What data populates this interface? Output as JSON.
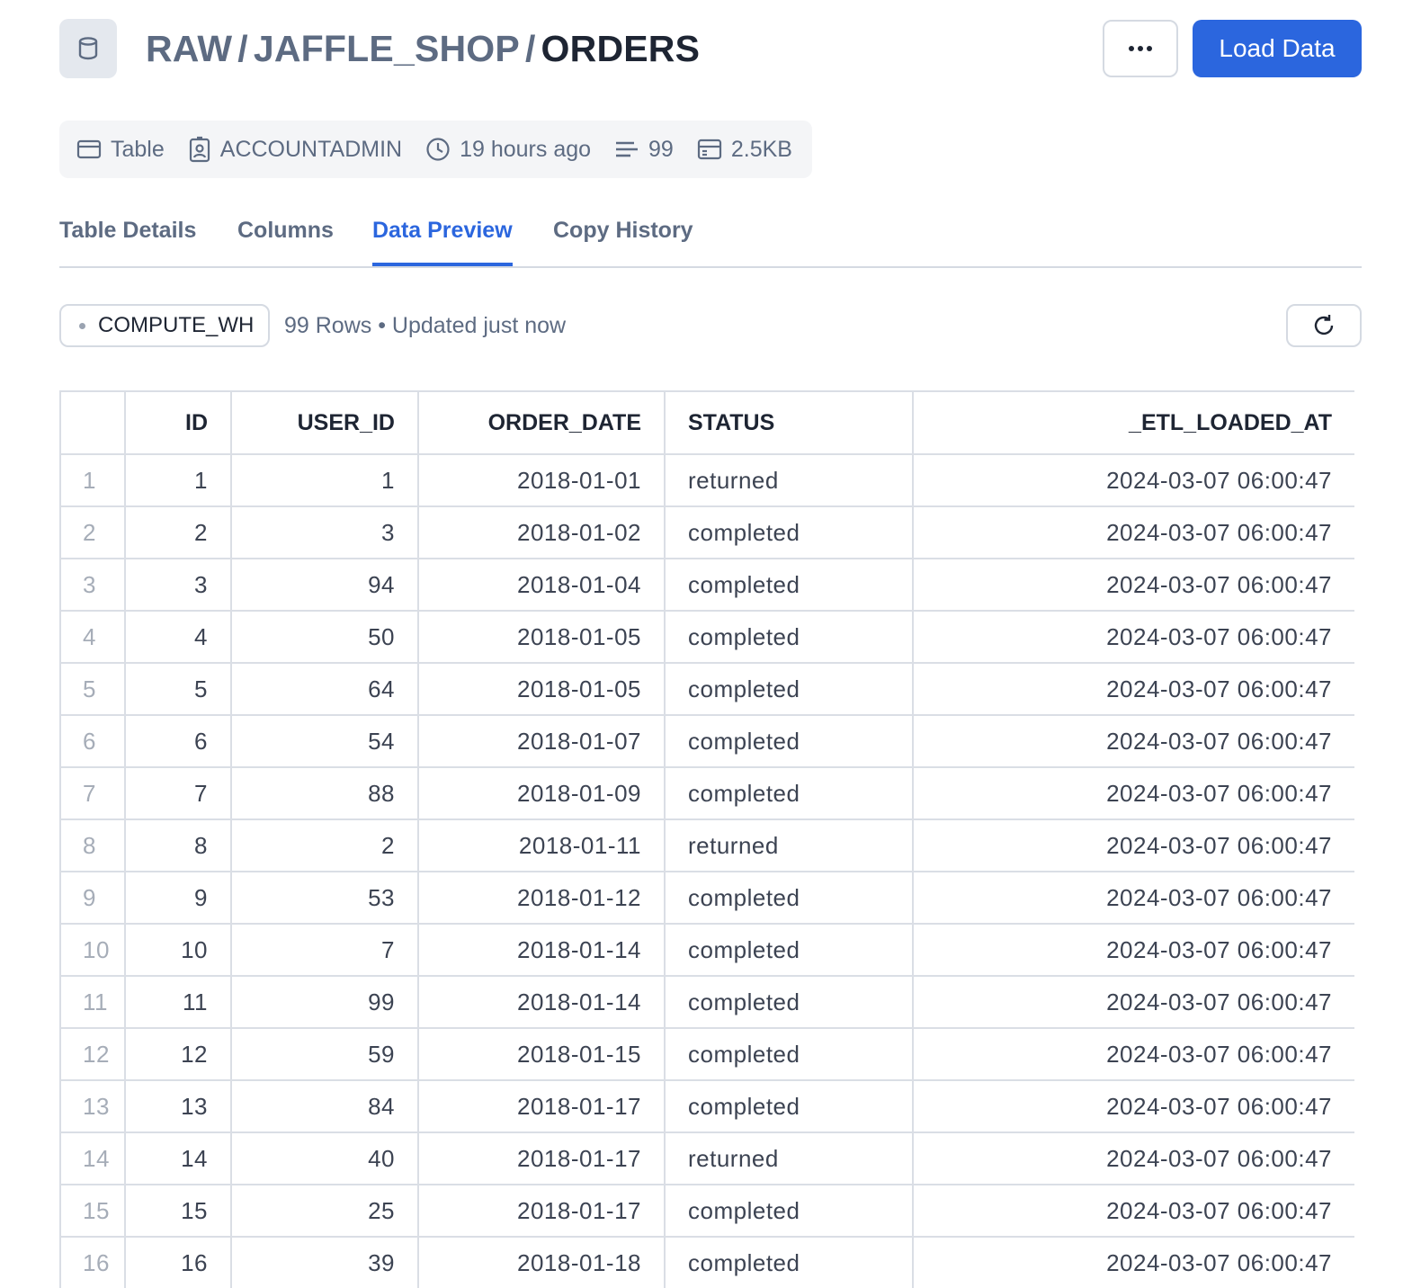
{
  "header": {
    "breadcrumb": [
      "RAW",
      "JAFFLE_SHOP"
    ],
    "separator": "/",
    "current": "ORDERS",
    "more_label": "•••",
    "load_label": "Load Data"
  },
  "meta": {
    "type": "Table",
    "owner": "ACCOUNTADMIN",
    "updated": "19 hours ago",
    "rows": "99",
    "size": "2.5KB"
  },
  "tabs": [
    "Table Details",
    "Columns",
    "Data Preview",
    "Copy History"
  ],
  "active_tab": "Data Preview",
  "toolbar": {
    "warehouse": "COMPUTE_WH",
    "row_info": "99 Rows • Updated just now"
  },
  "colors": {
    "accent": "#2b66de",
    "muted_text": "#5d6b82",
    "border": "#d5dae2"
  },
  "grid": {
    "columns": [
      "",
      "ID",
      "USER_ID",
      "ORDER_DATE",
      "STATUS",
      "_ETL_LOADED_AT"
    ],
    "rows": [
      [
        "1",
        "1",
        "1",
        "2018-01-01",
        "returned",
        "2024-03-07 06:00:47"
      ],
      [
        "2",
        "2",
        "3",
        "2018-01-02",
        "completed",
        "2024-03-07 06:00:47"
      ],
      [
        "3",
        "3",
        "94",
        "2018-01-04",
        "completed",
        "2024-03-07 06:00:47"
      ],
      [
        "4",
        "4",
        "50",
        "2018-01-05",
        "completed",
        "2024-03-07 06:00:47"
      ],
      [
        "5",
        "5",
        "64",
        "2018-01-05",
        "completed",
        "2024-03-07 06:00:47"
      ],
      [
        "6",
        "6",
        "54",
        "2018-01-07",
        "completed",
        "2024-03-07 06:00:47"
      ],
      [
        "7",
        "7",
        "88",
        "2018-01-09",
        "completed",
        "2024-03-07 06:00:47"
      ],
      [
        "8",
        "8",
        "2",
        "2018-01-11",
        "returned",
        "2024-03-07 06:00:47"
      ],
      [
        "9",
        "9",
        "53",
        "2018-01-12",
        "completed",
        "2024-03-07 06:00:47"
      ],
      [
        "10",
        "10",
        "7",
        "2018-01-14",
        "completed",
        "2024-03-07 06:00:47"
      ],
      [
        "11",
        "11",
        "99",
        "2018-01-14",
        "completed",
        "2024-03-07 06:00:47"
      ],
      [
        "12",
        "12",
        "59",
        "2018-01-15",
        "completed",
        "2024-03-07 06:00:47"
      ],
      [
        "13",
        "13",
        "84",
        "2018-01-17",
        "completed",
        "2024-03-07 06:00:47"
      ],
      [
        "14",
        "14",
        "40",
        "2018-01-17",
        "returned",
        "2024-03-07 06:00:47"
      ],
      [
        "15",
        "15",
        "25",
        "2018-01-17",
        "completed",
        "2024-03-07 06:00:47"
      ],
      [
        "16",
        "16",
        "39",
        "2018-01-18",
        "completed",
        "2024-03-07 06:00:47"
      ]
    ]
  }
}
